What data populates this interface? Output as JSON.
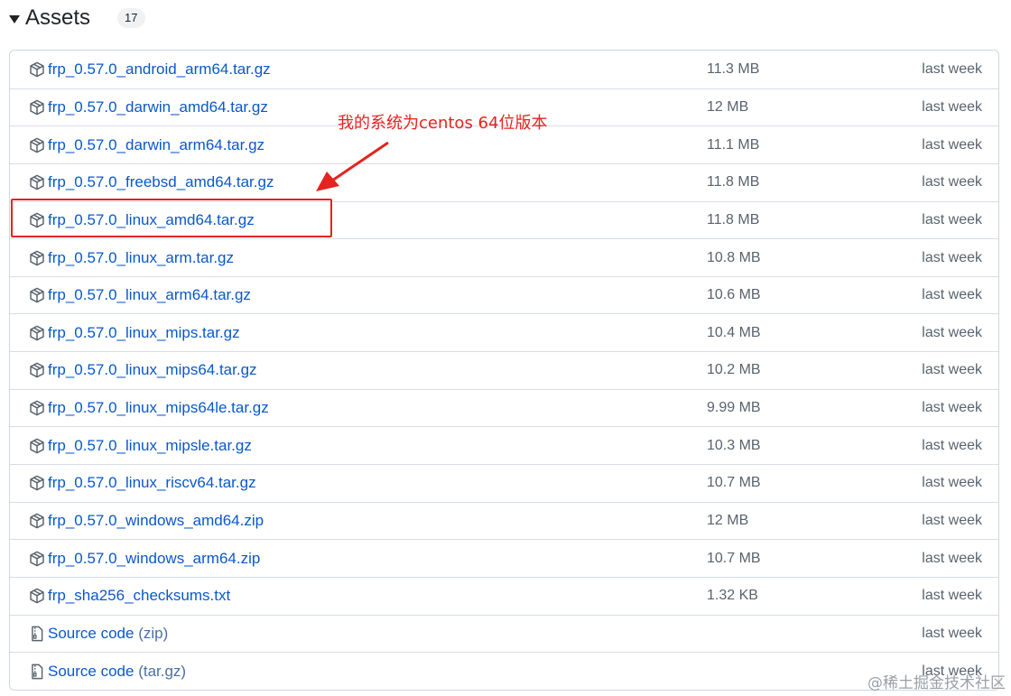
{
  "header": {
    "title": "Assets",
    "count": "17"
  },
  "assets": [
    {
      "name": "frp_0.57.0_android_arm64.tar.gz",
      "size": "11.3 MB",
      "date": "last week",
      "icon": "package-icon"
    },
    {
      "name": "frp_0.57.0_darwin_amd64.tar.gz",
      "size": "12 MB",
      "date": "last week",
      "icon": "package-icon"
    },
    {
      "name": "frp_0.57.0_darwin_arm64.tar.gz",
      "size": "11.1 MB",
      "date": "last week",
      "icon": "package-icon"
    },
    {
      "name": "frp_0.57.0_freebsd_amd64.tar.gz",
      "size": "11.8 MB",
      "date": "last week",
      "icon": "package-icon"
    },
    {
      "name": "frp_0.57.0_linux_amd64.tar.gz",
      "size": "11.8 MB",
      "date": "last week",
      "icon": "package-icon"
    },
    {
      "name": "frp_0.57.0_linux_arm.tar.gz",
      "size": "10.8 MB",
      "date": "last week",
      "icon": "package-icon"
    },
    {
      "name": "frp_0.57.0_linux_arm64.tar.gz",
      "size": "10.6 MB",
      "date": "last week",
      "icon": "package-icon"
    },
    {
      "name": "frp_0.57.0_linux_mips.tar.gz",
      "size": "10.4 MB",
      "date": "last week",
      "icon": "package-icon"
    },
    {
      "name": "frp_0.57.0_linux_mips64.tar.gz",
      "size": "10.2 MB",
      "date": "last week",
      "icon": "package-icon"
    },
    {
      "name": "frp_0.57.0_linux_mips64le.tar.gz",
      "size": "9.99 MB",
      "date": "last week",
      "icon": "package-icon"
    },
    {
      "name": "frp_0.57.0_linux_mipsle.tar.gz",
      "size": "10.3 MB",
      "date": "last week",
      "icon": "package-icon"
    },
    {
      "name": "frp_0.57.0_linux_riscv64.tar.gz",
      "size": "10.7 MB",
      "date": "last week",
      "icon": "package-icon"
    },
    {
      "name": "frp_0.57.0_windows_amd64.zip",
      "size": "12 MB",
      "date": "last week",
      "icon": "package-icon"
    },
    {
      "name": "frp_0.57.0_windows_arm64.zip",
      "size": "10.7 MB",
      "date": "last week",
      "icon": "package-icon"
    },
    {
      "name": "frp_sha256_checksums.txt",
      "size": "1.32 KB",
      "date": "last week",
      "icon": "package-icon"
    },
    {
      "name": "Source code",
      "suffix": "(zip)",
      "size": "",
      "date": "last week",
      "icon": "file-zip-icon"
    },
    {
      "name": "Source code",
      "suffix": "(tar.gz)",
      "size": "",
      "date": "last week",
      "icon": "file-zip-icon"
    }
  ],
  "annotation": {
    "text": "我的系统为centos 64位版本",
    "color": "#e5231f"
  },
  "watermark": "@稀土掘金技术社区",
  "colors": {
    "link": "#0a58ca",
    "muted": "#59636e",
    "border": "#d0d7de",
    "annotation": "#e5231f"
  }
}
